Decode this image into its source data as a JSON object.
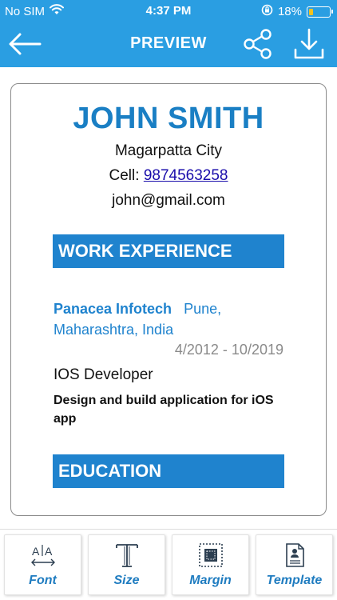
{
  "status_bar": {
    "carrier": "No SIM",
    "time": "4:37 PM",
    "battery_percent": "18%",
    "battery_level": 0.18
  },
  "nav": {
    "title": "PREVIEW",
    "back_icon": "arrow-left-icon",
    "share_icon": "share-icon",
    "download_icon": "download-icon"
  },
  "resume": {
    "name": "JOHN SMITH",
    "city": "Magarpatta City",
    "cell_label": "Cell: ",
    "cell_number": "9874563258",
    "email": "john@gmail.com",
    "work_heading": "WORK EXPERIENCE",
    "company": "Panacea Infotech",
    "location": "Pune, Maharashtra, India",
    "dates": "4/2012 - 10/2019",
    "role": "IOS Developer",
    "description": "Design and build application for iOS app",
    "education_heading": "EDUCATION"
  },
  "toolbar": {
    "items": [
      {
        "label": "Font",
        "icon": "font-size-icon"
      },
      {
        "label": "Size",
        "icon": "text-size-icon"
      },
      {
        "label": "Margin",
        "icon": "margin-icon"
      },
      {
        "label": "Template",
        "icon": "template-icon"
      }
    ]
  },
  "colors": {
    "primary": "#2a9ee2",
    "accent": "#1f83ce",
    "battery": "#f4c21f"
  }
}
